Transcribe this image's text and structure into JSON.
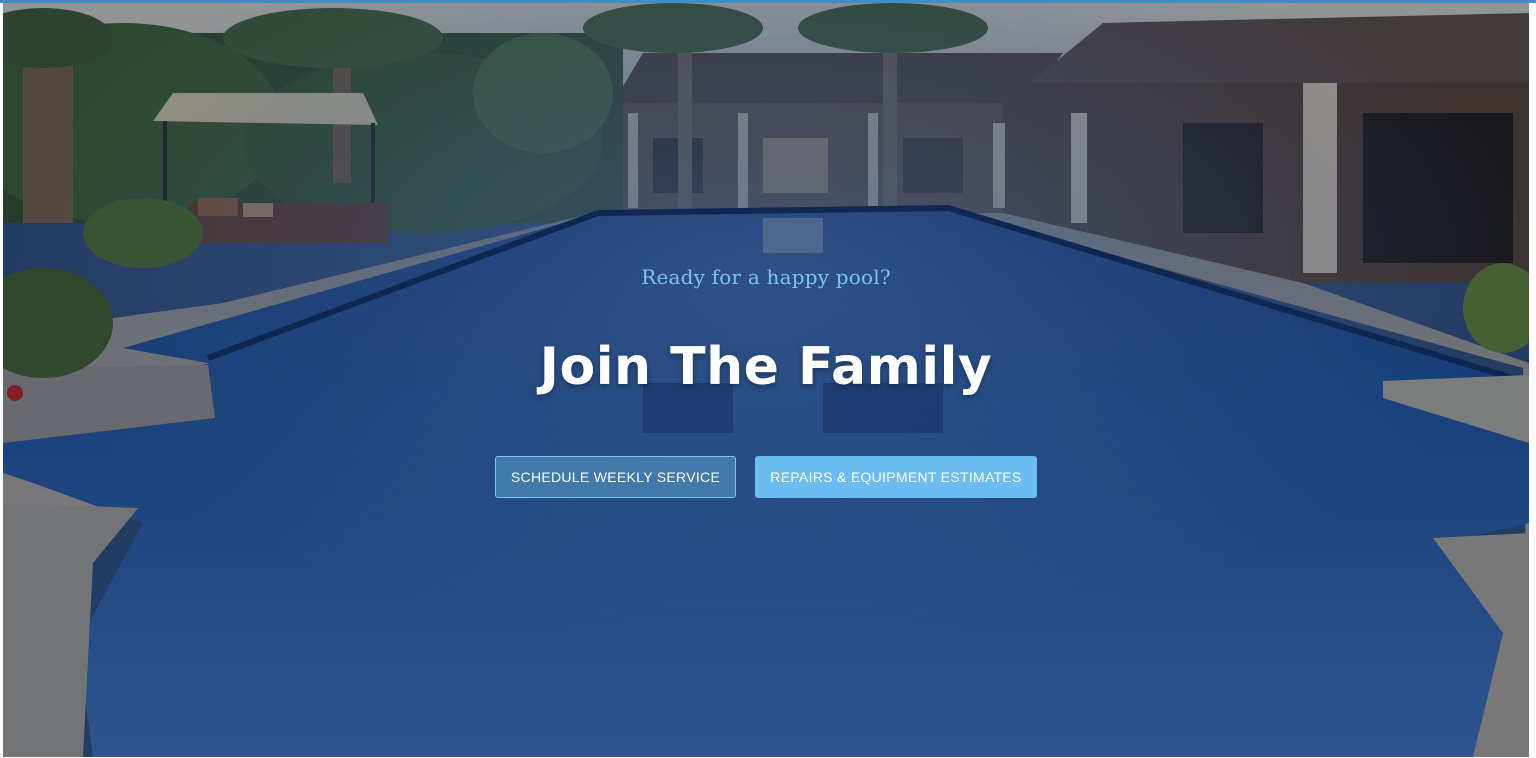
{
  "hero": {
    "kicker": "Ready for a happy pool?",
    "headline": "Join The Family",
    "background": "pool-backyard-photo"
  },
  "buttons": {
    "weekly_label": "SCHEDULE WEEKLY SERVICE",
    "repairs_label": "REPAIRS & EQUIPMENT ESTIMATES"
  },
  "colors": {
    "accent": "#7cc4f2",
    "button_primary": "#6bbcf0",
    "top_bar": "#3f8fc4"
  }
}
